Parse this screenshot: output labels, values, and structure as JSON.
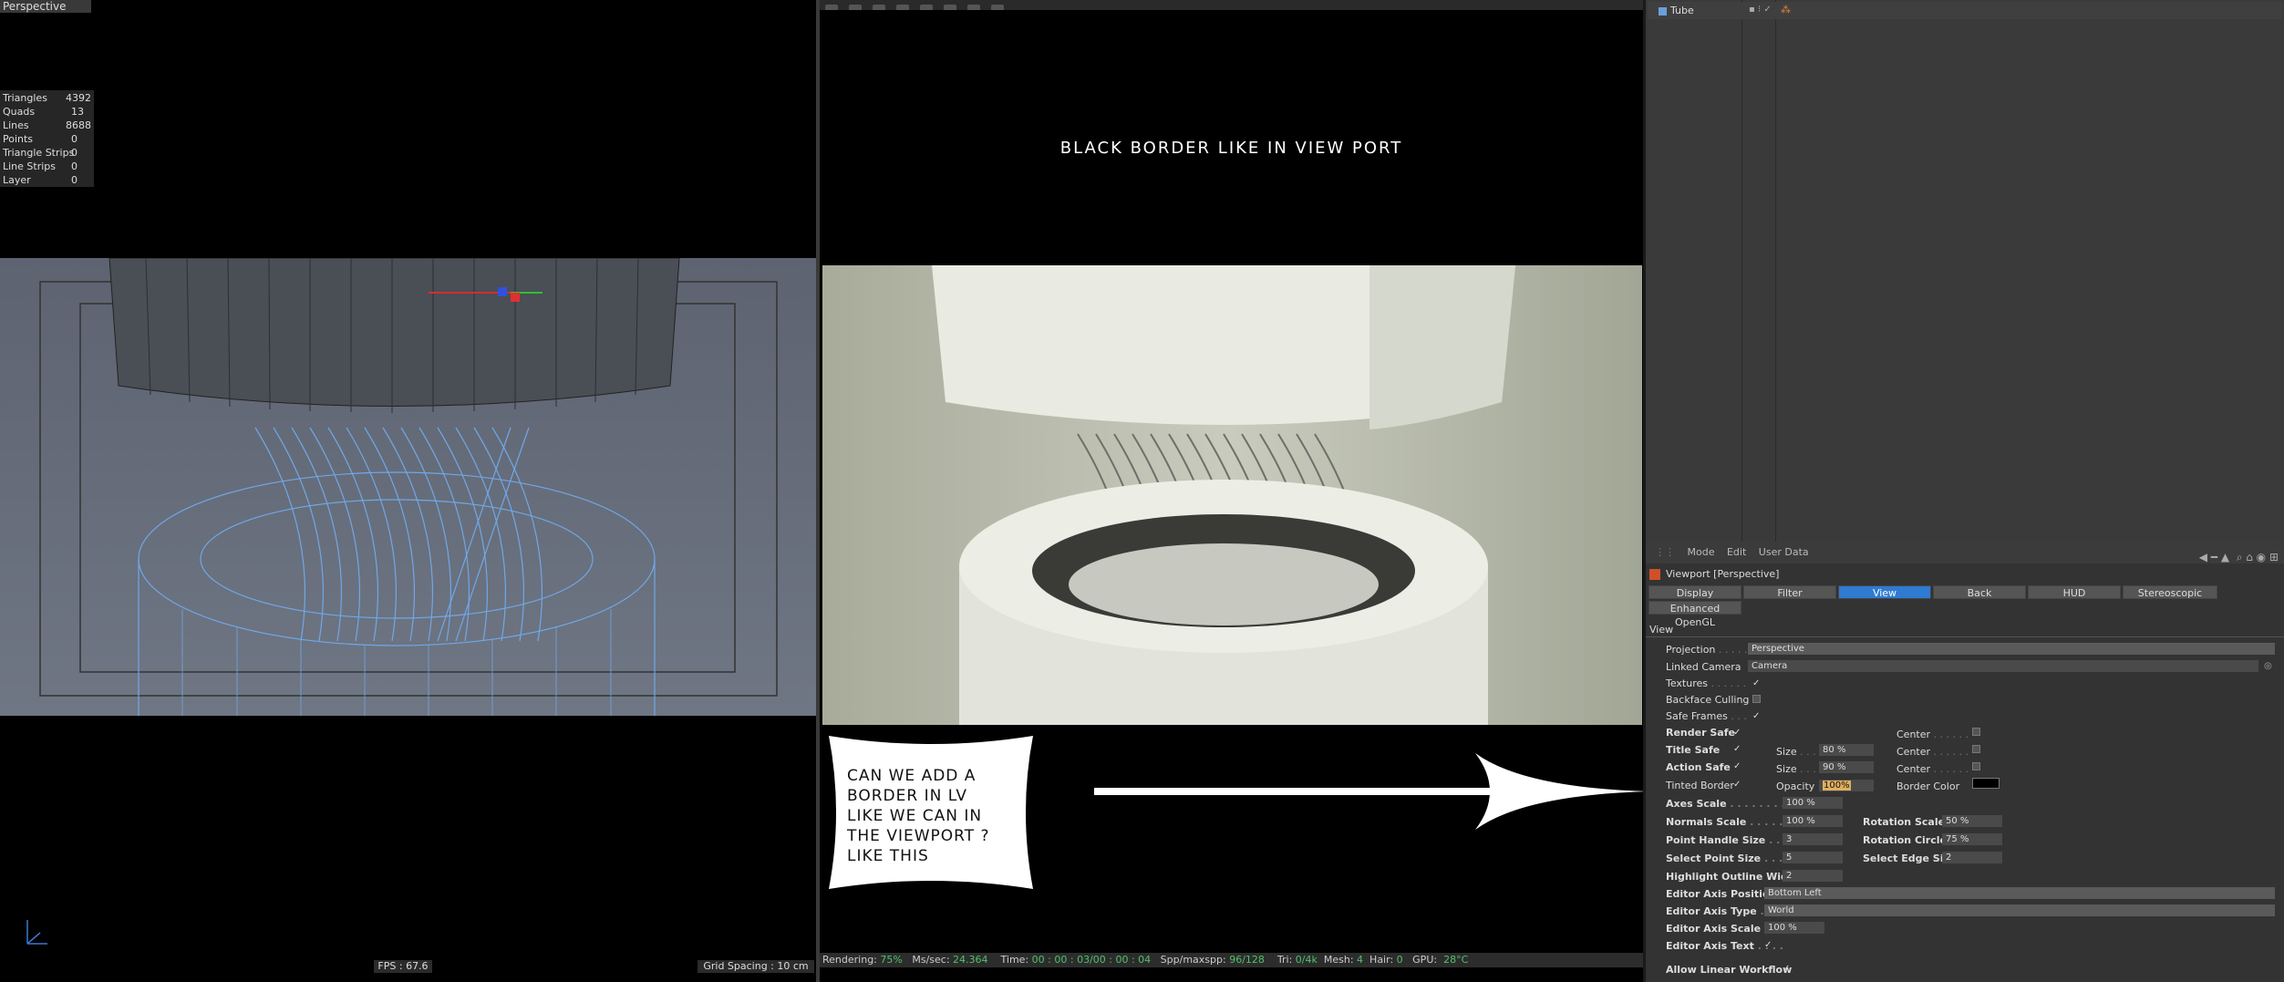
{
  "viewport": {
    "label": "Perspective",
    "stats": [
      {
        "name": "Triangles",
        "value": "4392"
      },
      {
        "name": "Quads",
        "value": "13"
      },
      {
        "name": "Lines",
        "value": "8688"
      },
      {
        "name": "Points",
        "value": "0"
      },
      {
        "name": "Triangle Strips",
        "value": "0"
      },
      {
        "name": "Line Strips",
        "value": "0"
      },
      {
        "name": "Layer",
        "value": "0"
      }
    ],
    "fps": "FPS : 67.6",
    "grid_spacing": "Grid Spacing : 10 cm"
  },
  "render_view": {
    "note_top": "BLACK BORDER LIKE IN VIEW PORT",
    "bubble_text": "CAN WE ADD A\nBORDER IN LV\nLIKE WE CAN IN\nTHE VIEWPORT ?\nLIKE THIS",
    "status": {
      "rendering_label": "Rendering:",
      "rendering_value": "75%",
      "ms_label": "Ms/sec:",
      "ms_value": "24.364",
      "time_label": "Time:",
      "time_value": "00 : 00 : 03/00 : 00 : 04",
      "spp_label": "Spp/maxspp:",
      "spp_value": "96/128",
      "tri_label": "Tri:",
      "tri_value": "0/4k",
      "mesh_label": "Mesh:",
      "mesh_value": "4",
      "hair_label": "Hair:",
      "hair_value": "0",
      "gpu_label": "GPU:",
      "gpu_value": "28°C"
    }
  },
  "object_manager": {
    "objects": [
      {
        "name": "Tube"
      }
    ]
  },
  "attributes": {
    "menu": [
      "Mode",
      "Edit",
      "User Data"
    ],
    "title": "Viewport [Perspective]",
    "tabs": [
      "Display",
      "Filter",
      "View",
      "Back",
      "HUD",
      "Stereoscopic",
      "Enhanced OpenGL"
    ],
    "active_tab": "View",
    "section": "View",
    "projection_label": "Projection",
    "projection_value": "Perspective",
    "linked_camera_label": "Linked Camera",
    "linked_camera_value": "Camera",
    "textures_label": "Textures",
    "backface_label": "Backface Culling",
    "safe_frames_label": "Safe Frames",
    "render_safe_label": "Render Safe",
    "title_safe_label": "Title Safe",
    "action_safe_label": "Action Safe",
    "tinted_border_label": "Tinted Border",
    "size_label": "Size",
    "title_size": "80 %",
    "action_size": "90 %",
    "center_label": "Center",
    "opacity_label": "Opacity",
    "opacity_value": "100%",
    "border_color_label": "Border Color",
    "axes_scale_label": "Axes Scale",
    "axes_scale_value": "100 %",
    "normals_scale_label": "Normals Scale",
    "normals_scale_value": "100 %",
    "rotation_scale_label": "Rotation Scale",
    "rotation_scale_value": "50 %",
    "point_handle_label": "Point Handle Size",
    "point_handle_value": "3",
    "rotation_circle_label": "Rotation Circle",
    "rotation_circle_value": "75 %",
    "select_point_label": "Select Point Size",
    "select_point_value": "5",
    "select_edge_label": "Select Edge Size",
    "select_edge_value": "2",
    "highlight_label": "Highlight Outline Width",
    "highlight_value": "2",
    "axis_position_label": "Editor Axis Position",
    "axis_position_value": "Bottom Left",
    "axis_type_label": "Editor Axis Type",
    "axis_type_value": "World",
    "axis_scale_label": "Editor Axis Scale",
    "axis_scale_value": "100 %",
    "axis_text_label": "Editor Axis Text",
    "linear_workflow_label": "Allow Linear Workflow"
  }
}
